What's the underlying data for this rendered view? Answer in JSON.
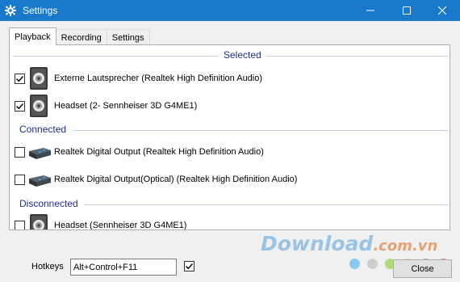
{
  "window": {
    "title": "Settings"
  },
  "tabs": [
    {
      "label": "Playback",
      "active": true
    },
    {
      "label": "Recording",
      "active": false
    },
    {
      "label": "Settings",
      "active": false
    }
  ],
  "groups": {
    "selected": "Selected",
    "connected": "Connected",
    "disconnected": "Disconnected"
  },
  "devices": [
    {
      "label": "Externe Lautsprecher (Realtek High Definition Audio)",
      "checked": true,
      "icon": "speaker-icon"
    },
    {
      "label": "Headset (2- Sennheiser 3D G4ME1)",
      "checked": true,
      "icon": "speaker-icon"
    },
    {
      "label": "Realtek Digital Output (Realtek High Definition Audio)",
      "checked": false,
      "icon": "digital-output-icon"
    },
    {
      "label": "Realtek Digital Output(Optical) (Realtek High Definition Audio)",
      "checked": false,
      "icon": "digital-output-icon"
    },
    {
      "label": "Headset (Sennheiser 3D G4ME1)",
      "checked": false,
      "icon": "speaker-icon"
    }
  ],
  "hotkeys": {
    "label": "Hotkeys",
    "value": "Alt+Control+F11",
    "checked": true
  },
  "close_button": {
    "label": "Close"
  },
  "watermark": {
    "main": "Download",
    "tld": ".com.vn"
  },
  "colors": {
    "titlebar": "#1979ca",
    "group_header": "#1e3287"
  },
  "watermark_dots": [
    "#7cc4ee",
    "#c9c9c9",
    "#a8d86c",
    "#f5c26a",
    "#6aa6d9",
    "#e66b6b"
  ]
}
